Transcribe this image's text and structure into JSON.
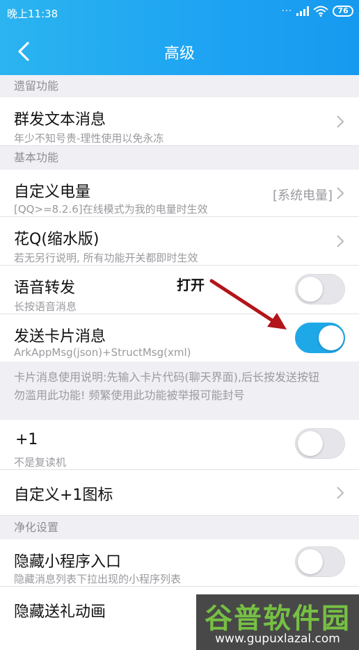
{
  "status_bar": {
    "time": "晚上11:38",
    "battery": "76"
  },
  "nav": {
    "title": "高级"
  },
  "sections": {
    "legacy": "遗留功能",
    "basic": "基本功能",
    "purify": "净化设置"
  },
  "items": {
    "mass_text": {
      "title": "群发文本消息",
      "subtitle": "年少不知号贵-理性使用以免永冻"
    },
    "battery": {
      "title": "自定义电量",
      "subtitle": "[QQ>=8.2.6]在线模式为我的电量时生效",
      "value": "[系统电量]"
    },
    "huaq": {
      "title": "花Q(缩水版)",
      "subtitle": "若无另行说明, 所有功能开关都即时生效"
    },
    "voice_forward": {
      "title": "语音转发",
      "subtitle": "长按语音消息",
      "enabled": false
    },
    "card_msg": {
      "title": "发送卡片消息",
      "subtitle": "ArkAppMsg(json)+StructMsg(xml)",
      "enabled": true
    },
    "plus_one": {
      "title": "+1",
      "subtitle": "不是复读机",
      "enabled": false
    },
    "plus_one_icon": {
      "title": "自定义+1图标"
    },
    "hide_mini": {
      "title": "隐藏小程序入口",
      "subtitle": "隐藏消息列表下拉出现的小程序列表",
      "enabled": false
    },
    "hide_gift": {
      "title": "隐藏送礼动画"
    }
  },
  "card_note": {
    "line1": "卡片消息使用说明:先输入卡片代码(聊天界面),后长按发送按钮",
    "line2": "勿滥用此功能! 频繁使用此功能被举报可能封号"
  },
  "annotation": {
    "label": "打开"
  },
  "watermark": {
    "name": "谷普软件园",
    "url": "www.gupuxlazal.com"
  },
  "colors": {
    "header": "#1da3f2",
    "switch_on": "#1fa8e8",
    "arrow": "#b3151b",
    "watermark_green": "#76c043"
  }
}
